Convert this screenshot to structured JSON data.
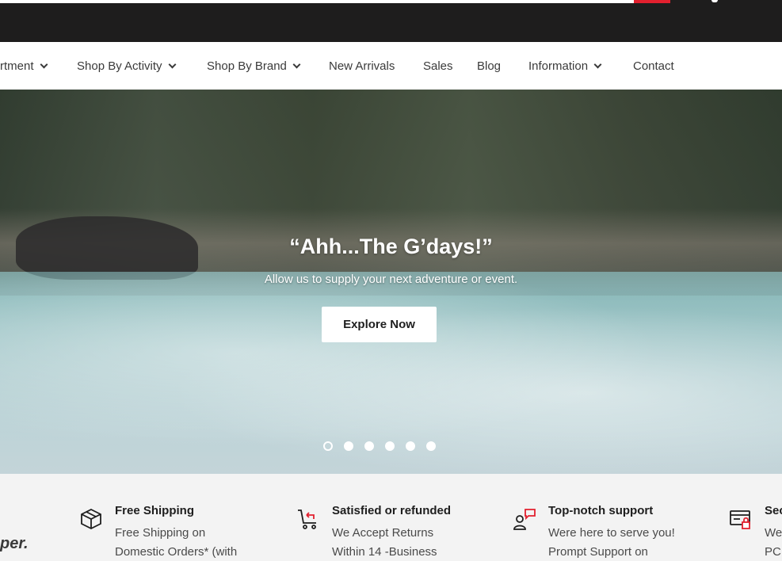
{
  "nav": {
    "items": [
      {
        "label": "rtment",
        "dropdown": true
      },
      {
        "label": "Shop By Activity",
        "dropdown": true
      },
      {
        "label": "Shop By Brand",
        "dropdown": true
      },
      {
        "label": "New Arrivals",
        "dropdown": false
      },
      {
        "label": "Sales",
        "dropdown": false
      },
      {
        "label": "Blog",
        "dropdown": false
      },
      {
        "label": "Information",
        "dropdown": true
      },
      {
        "label": "Contact",
        "dropdown": false
      }
    ]
  },
  "hero": {
    "title": "“Ahh...The G’days!”",
    "subtitle": "Allow us to supply your next adventure or event.",
    "button_label": "Explore Now",
    "slide_count": 6,
    "active_slide": 1
  },
  "features": {
    "tagline": "per.",
    "items": [
      {
        "icon": "box-icon",
        "title": "Free Shipping",
        "line1": "Free Shipping on",
        "line2": "Domestic Orders* (with"
      },
      {
        "icon": "cart-return-icon",
        "title": "Satisfied or refunded",
        "line1": "We Accept Returns",
        "line2": "Within 14 -Business"
      },
      {
        "icon": "support-icon",
        "title": "Top-notch support",
        "line1": "Were here to serve you!",
        "line2": "Prompt Support on"
      },
      {
        "icon": "secure-payment-icon",
        "title": "Sec",
        "line1": "We",
        "line2": "PCI"
      }
    ]
  },
  "colors": {
    "topbar": "#1e1d1d",
    "accent": "#e2202e",
    "features_bg": "#f3f3f3"
  }
}
